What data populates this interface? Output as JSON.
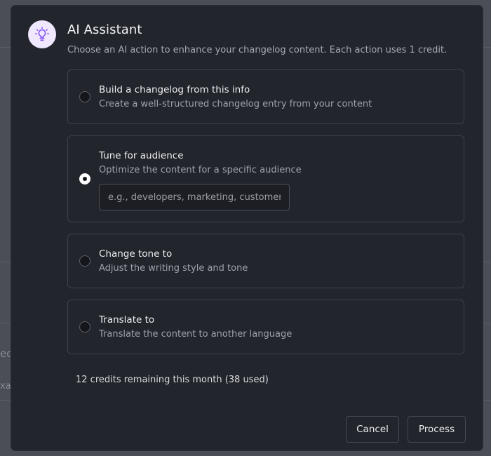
{
  "background": {
    "text_1": "ed",
    "text_2": "xa"
  },
  "dialog": {
    "icon": "lightbulb-icon",
    "accent_color": "#8b5cf6",
    "title": "AI Assistant",
    "subtitle": "Choose an AI action to enhance your changelog content. Each action uses 1 credit.",
    "options": [
      {
        "title": "Build a changelog from this info",
        "description": "Create a well-structured changelog entry from your content",
        "selected": false
      },
      {
        "title": "Tune for audience",
        "description": "Optimize the content for a specific audience",
        "selected": true,
        "input_placeholder": "e.g., developers, marketing, customers",
        "input_value": ""
      },
      {
        "title": "Change tone to",
        "description": "Adjust the writing style and tone",
        "selected": false
      },
      {
        "title": "Translate to",
        "description": "Translate the content to another language",
        "selected": false
      }
    ],
    "credits_text": "12 credits remaining this month (38 used)",
    "cancel_label": "Cancel",
    "process_label": "Process"
  }
}
